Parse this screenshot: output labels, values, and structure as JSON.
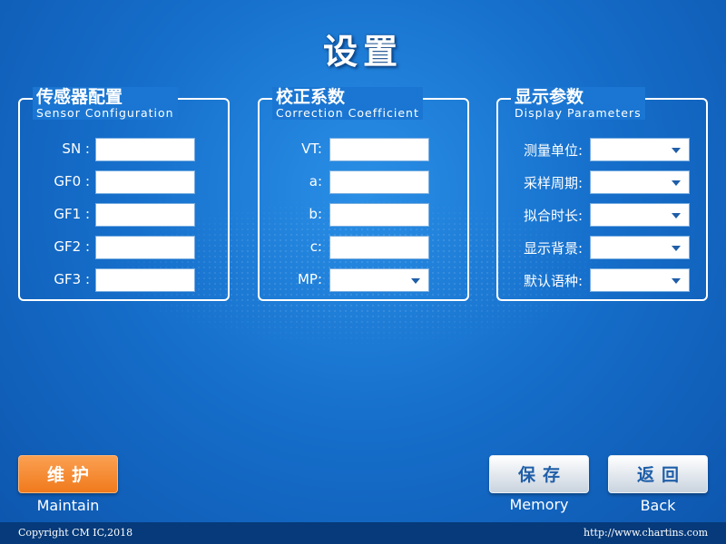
{
  "page": {
    "title": "设置"
  },
  "panels": [
    {
      "title_cn": "传感器配置",
      "title_en": "Sensor Configuration",
      "rows": [
        {
          "label": "SN :",
          "value": "",
          "type": "input"
        },
        {
          "label": "GF0 :",
          "value": "",
          "type": "input"
        },
        {
          "label": "GF1 :",
          "value": "",
          "type": "input"
        },
        {
          "label": "GF2 :",
          "value": "",
          "type": "input"
        },
        {
          "label": "GF3 :",
          "value": "",
          "type": "input"
        }
      ]
    },
    {
      "title_cn": "校正系数",
      "title_en": "Correction Coefficient",
      "rows": [
        {
          "label": "VT:",
          "value": "",
          "type": "input"
        },
        {
          "label": "a:",
          "value": "",
          "type": "input"
        },
        {
          "label": "b:",
          "value": "",
          "type": "input"
        },
        {
          "label": "c:",
          "value": "",
          "type": "input"
        },
        {
          "label": "MP:",
          "value": "",
          "type": "select"
        }
      ]
    },
    {
      "title_cn": "显示参数",
      "title_en": "Display Parameters",
      "rows": [
        {
          "label": "测量单位:",
          "value": "",
          "type": "select"
        },
        {
          "label": "采样周期:",
          "value": "",
          "type": "select"
        },
        {
          "label": "拟合时长:",
          "value": "",
          "type": "select"
        },
        {
          "label": "显示背景:",
          "value": "",
          "type": "select"
        },
        {
          "label": "默认语种:",
          "value": "",
          "type": "select"
        }
      ]
    }
  ],
  "buttons": {
    "maintain": {
      "label": "维护",
      "caption": "Maintain"
    },
    "memory": {
      "label": "保存",
      "caption": "Memory"
    },
    "back": {
      "label": "返回",
      "caption": "Back"
    }
  },
  "footer": {
    "copyright": "Copyright CM IC,2018",
    "website": "http://www.chartins.com"
  },
  "colors": {
    "background": "#1670cc",
    "maintain_button": "#f07a1c",
    "silver_button": "#dfe6ee",
    "footer": "#063a7a"
  },
  "icons": {
    "dropdown": "chevron-down-icon"
  }
}
